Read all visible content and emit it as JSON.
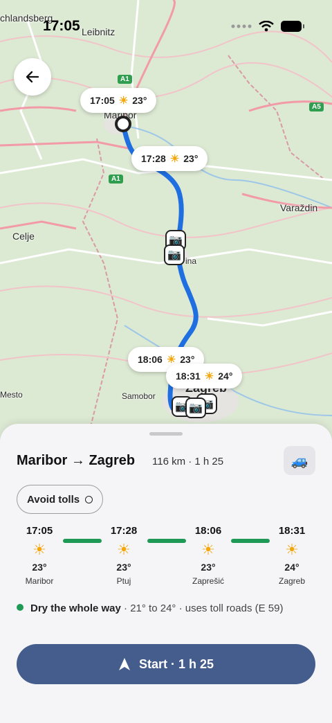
{
  "status": {
    "time": "17:05"
  },
  "map": {
    "places": [
      {
        "id": "leibnitz",
        "name": "Leibnitz"
      },
      {
        "id": "deutschlandsberg",
        "name": "chlandsberg"
      },
      {
        "id": "maribor",
        "name": "Maribor"
      },
      {
        "id": "celje",
        "name": "Celje"
      },
      {
        "id": "varazdin",
        "name": "Varaždin"
      },
      {
        "id": "ptuj",
        "name": "ina"
      },
      {
        "id": "samobor",
        "name": "Samobor"
      },
      {
        "id": "mesto",
        "name": "Mesto"
      },
      {
        "id": "zagreb",
        "name": "Zagreb"
      }
    ],
    "road_badges": [
      "A1",
      "A1",
      "A5"
    ],
    "weather_pins": [
      {
        "time": "17:05",
        "icon": "sun-icon",
        "temp": "23°"
      },
      {
        "time": "17:28",
        "icon": "sun-icon",
        "temp": "23°"
      },
      {
        "time": "18:06",
        "icon": "sun-icon",
        "temp": "23°"
      },
      {
        "time": "18:31",
        "icon": "sun-icon",
        "temp": "24°"
      }
    ],
    "route_color": "#1f6fe0"
  },
  "sheet": {
    "title": "Maribor → Zagreb",
    "meta": "116 km · 1 h 25",
    "avoid_tolls_label": "Avoid tolls",
    "stops": [
      {
        "time": "17:05",
        "icon": "sun-icon",
        "temp": "23°",
        "city": "Maribor"
      },
      {
        "time": "17:28",
        "icon": "sun-icon",
        "temp": "23°",
        "city": "Ptuj"
      },
      {
        "time": "18:06",
        "icon": "sun-icon",
        "temp": "23°",
        "city": "Zaprešić"
      },
      {
        "time": "18:31",
        "icon": "sun-icon",
        "temp": "24°",
        "city": "Zagreb"
      }
    ],
    "summary_bold": "Dry the whole way",
    "summary_rest": " · 21° to 24° · uses toll roads (E 59)",
    "start_label": "Start · 1 h 25",
    "accent": "#445d8c",
    "good_color": "#1f9a56"
  }
}
